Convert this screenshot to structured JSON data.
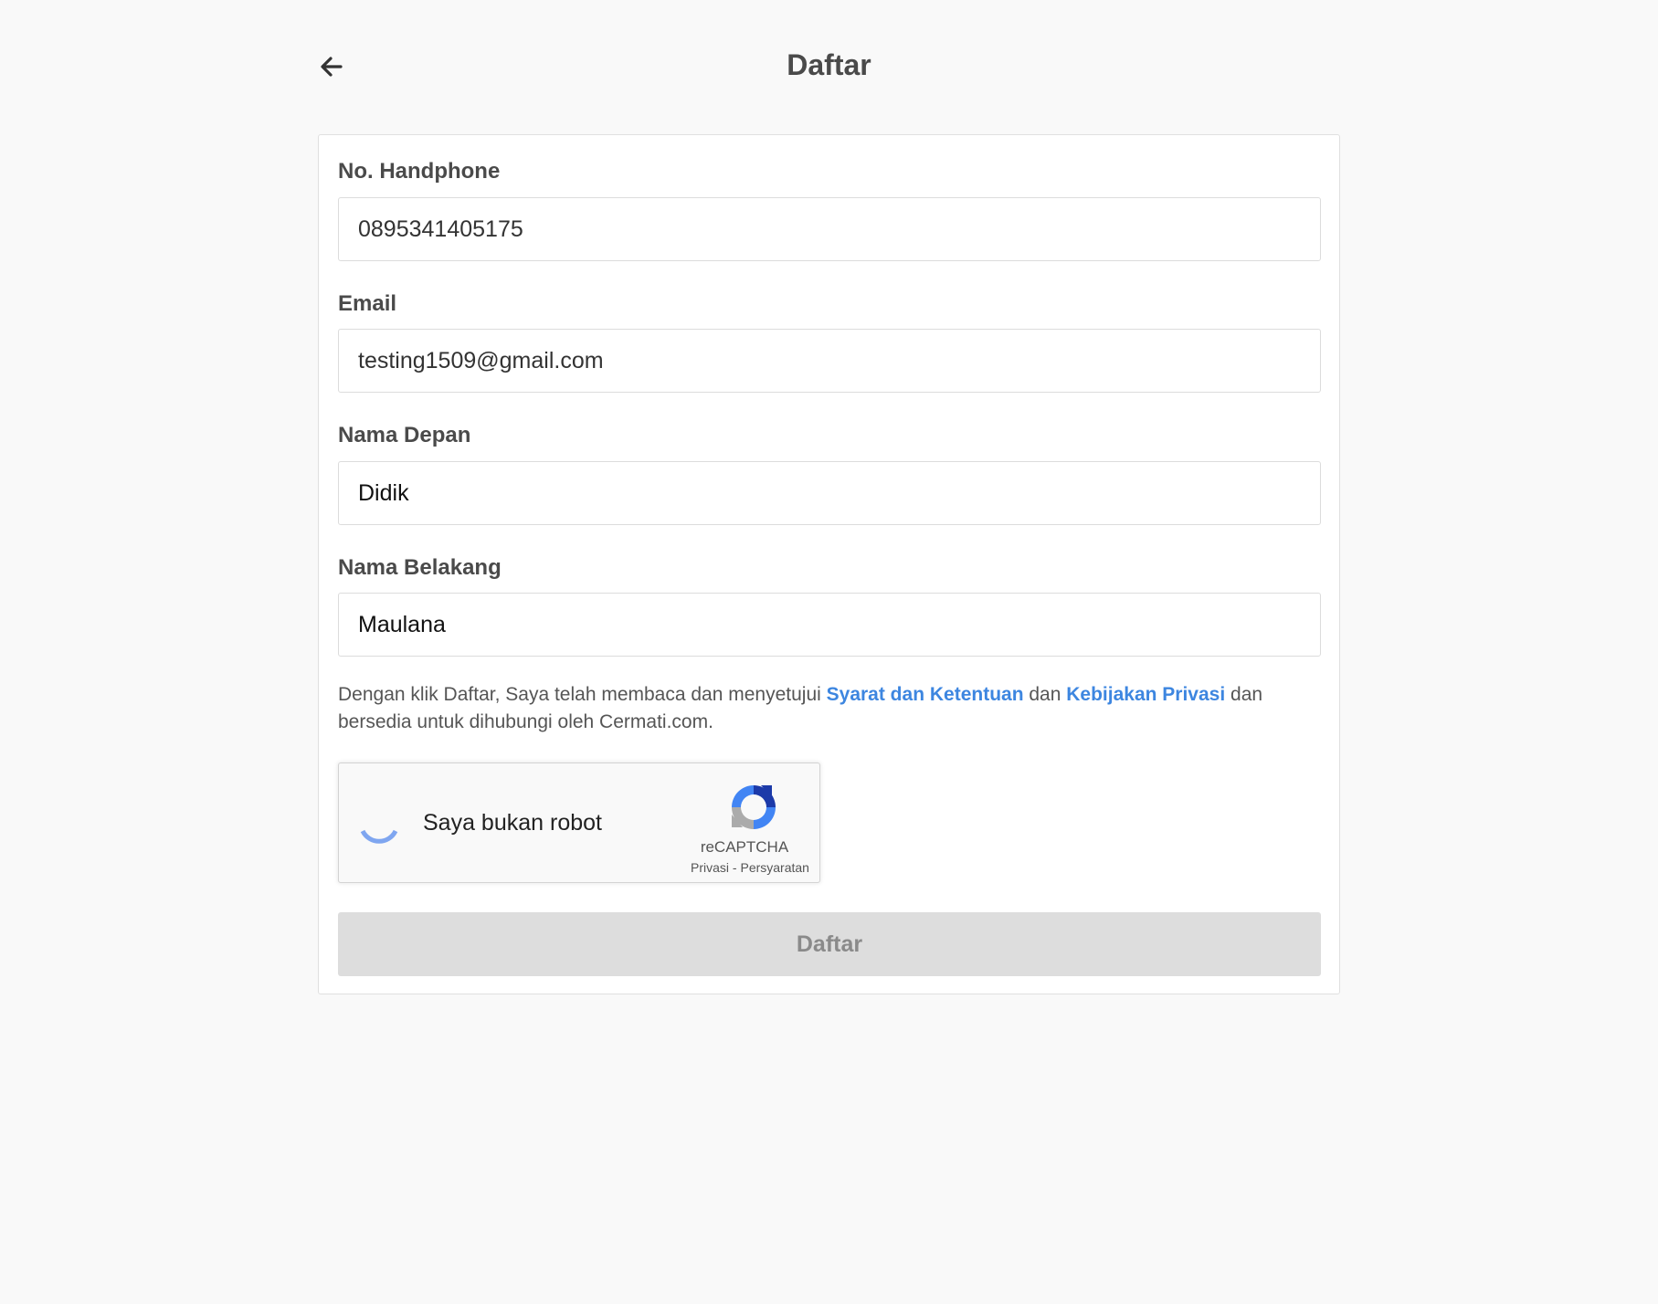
{
  "header": {
    "title": "Daftar",
    "back_icon": "arrow-left-icon"
  },
  "form": {
    "phone": {
      "label": "No. Handphone",
      "value": "0895341405175"
    },
    "email": {
      "label": "Email",
      "value": "testing1509@gmail.com"
    },
    "first_name": {
      "label": "Nama Depan",
      "value": "Didik"
    },
    "last_name": {
      "label": "Nama Belakang",
      "value": "Maulana"
    }
  },
  "terms": {
    "prefix": "Dengan klik Daftar, Saya telah membaca dan menyetujui ",
    "terms_link": "Syarat dan Ketentuan",
    "middle": " dan ",
    "privacy_link": "Kebijakan Privasi",
    "suffix": " dan bersedia untuk dihubungi oleh Cermati.com."
  },
  "recaptcha": {
    "label": "Saya bukan robot",
    "brand": "reCAPTCHA",
    "privacy": "Privasi",
    "separator": " - ",
    "terms": "Persyaratan"
  },
  "submit": {
    "label": "Daftar"
  },
  "colors": {
    "link": "#3d86e0",
    "button_disabled_bg": "#dddddd",
    "button_disabled_text": "#8a8a8a",
    "page_bg": "#f9f9f9"
  }
}
